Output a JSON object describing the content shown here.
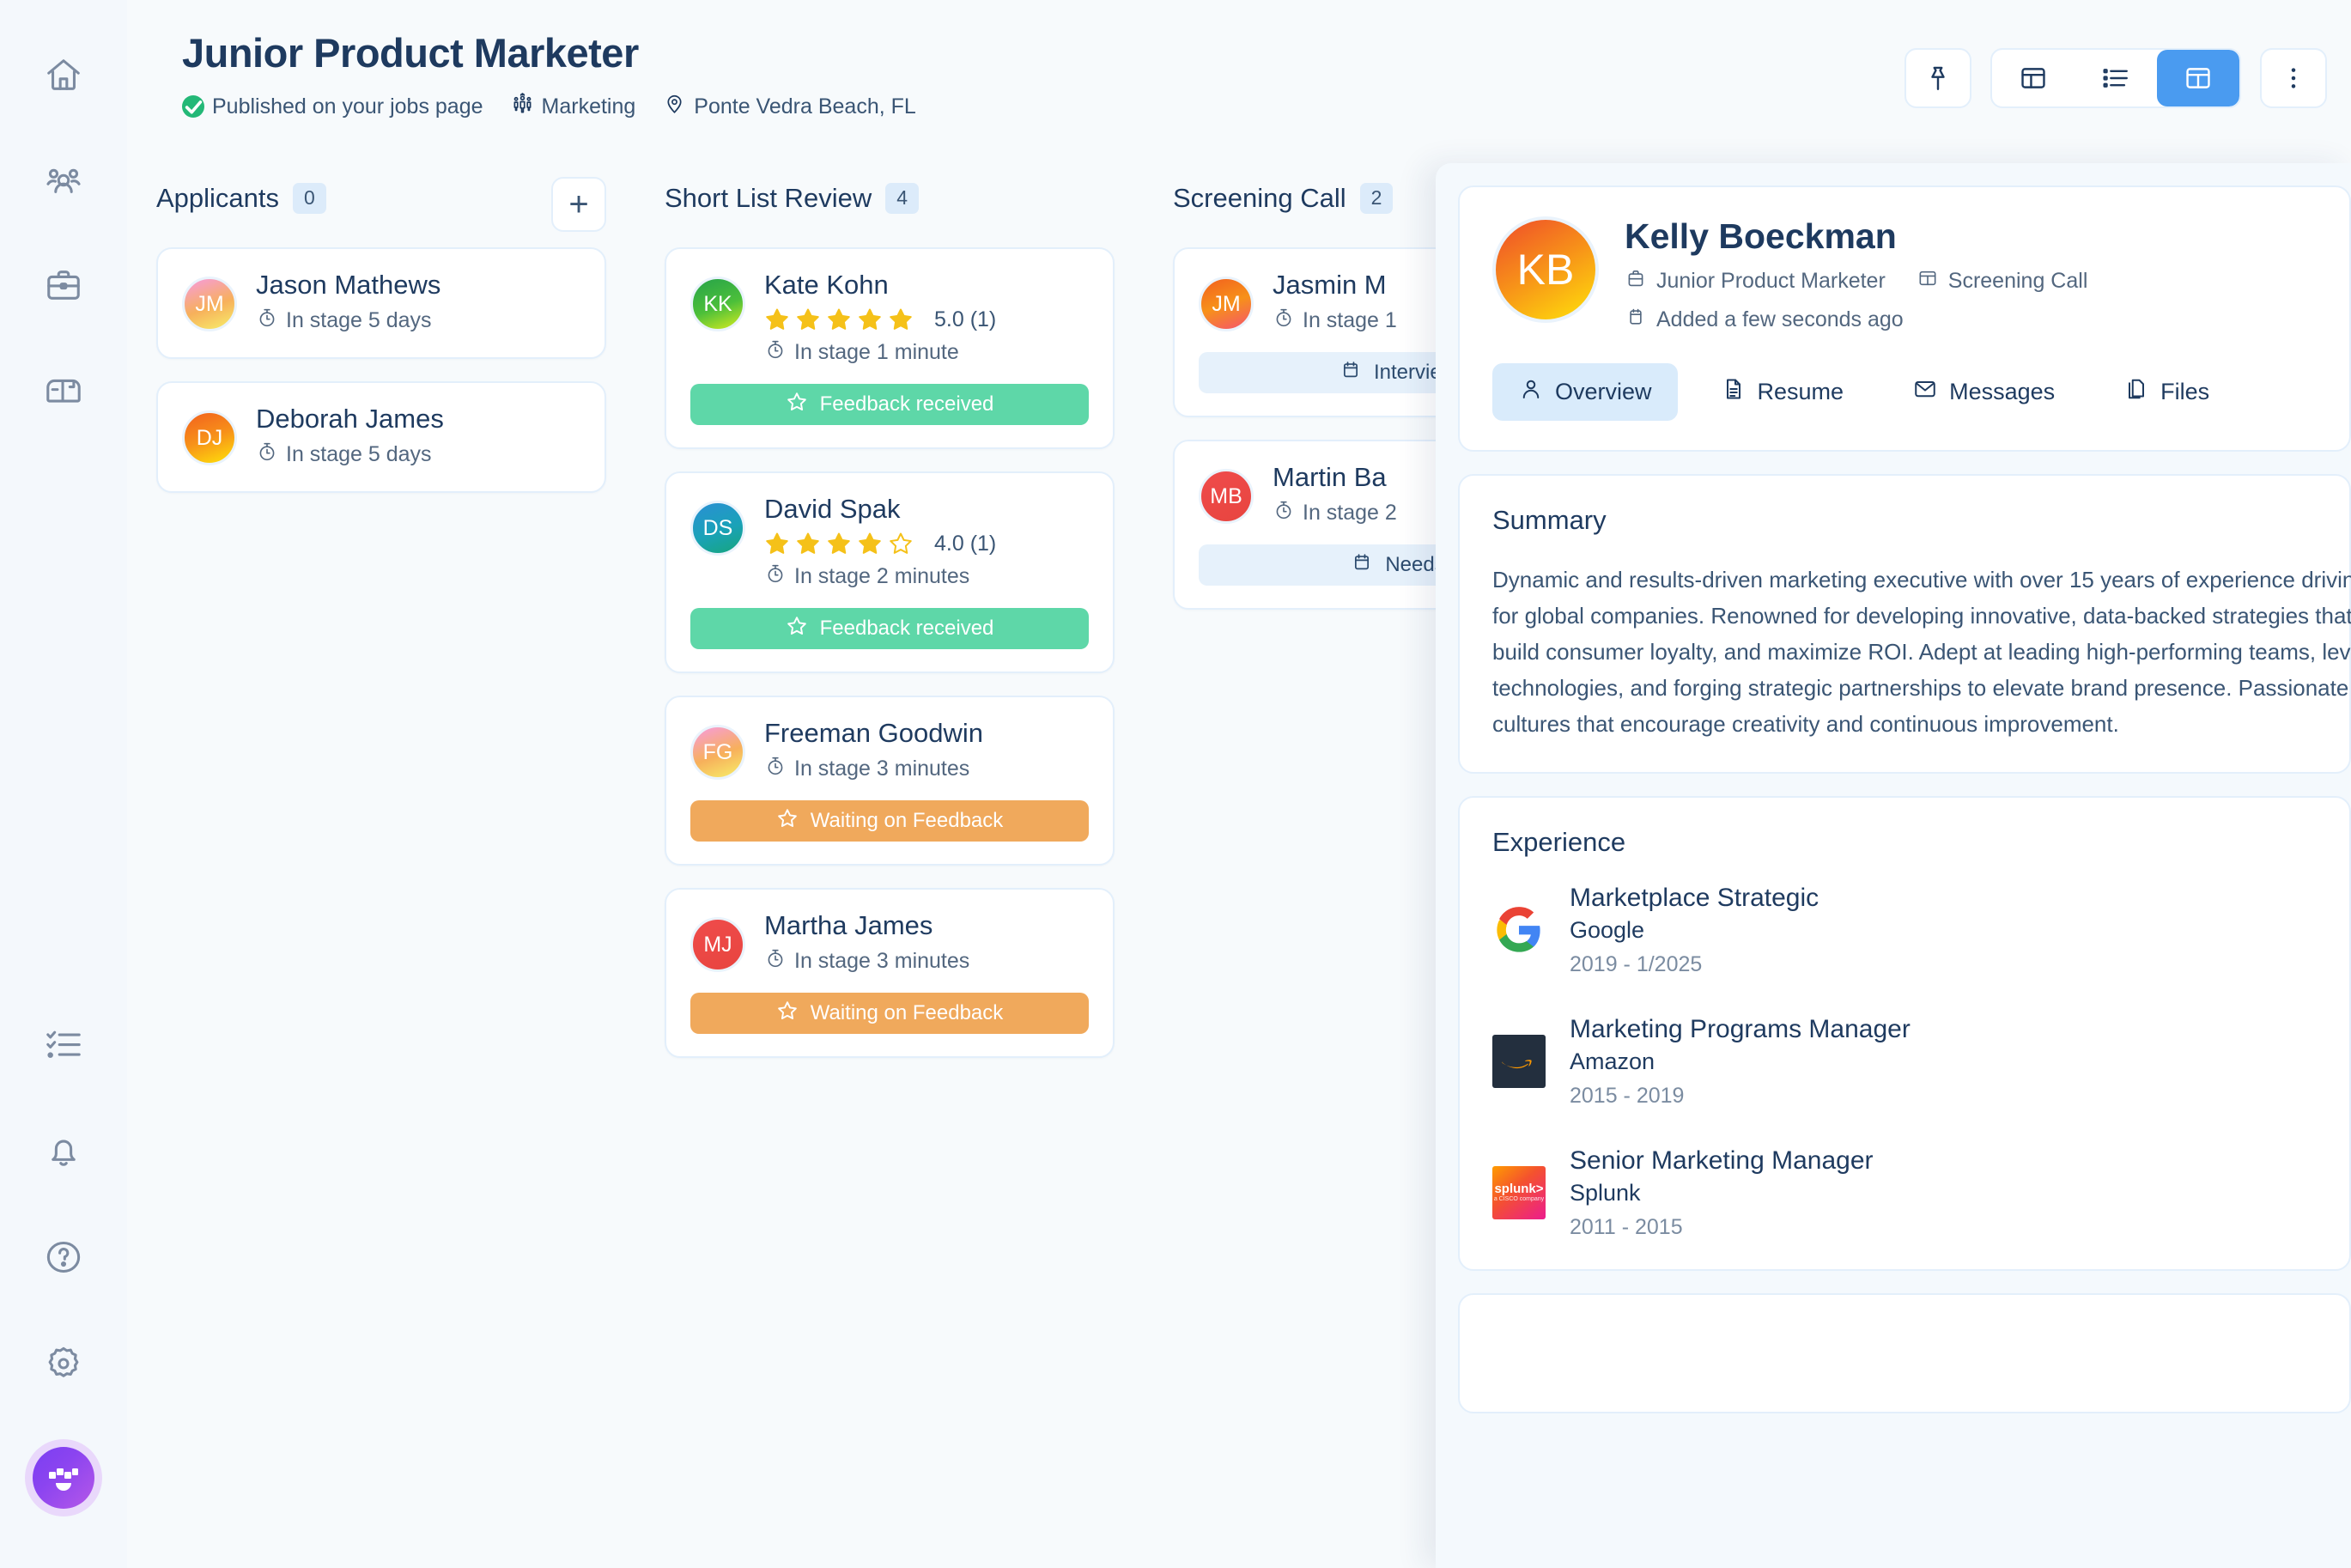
{
  "sidebar": {
    "top_items": [
      {
        "name": "home",
        "icon": "home-icon"
      },
      {
        "name": "people",
        "icon": "people-icon"
      },
      {
        "name": "jobs",
        "icon": "briefcase-icon"
      },
      {
        "name": "inbox",
        "icon": "mailbox-icon"
      }
    ],
    "bottom_items": [
      {
        "name": "tasks",
        "icon": "checklist-icon"
      },
      {
        "name": "notifications",
        "icon": "bell-icon"
      },
      {
        "name": "help",
        "icon": "question-circle-icon"
      },
      {
        "name": "settings",
        "icon": "gear-icon"
      }
    ],
    "account_avatar": "workstream-logo"
  },
  "header": {
    "title": "Junior Product Marketer",
    "published_label": "Published on your jobs page",
    "department": "Marketing",
    "location": "Ponte Vedra Beach, FL"
  },
  "toolbar": {
    "pin_label": "pin-icon",
    "view_panel_label": "panel-view-icon",
    "view_list_label": "list-view-icon",
    "view_split_label": "split-view-icon",
    "more_label": "more-vertical-icon",
    "active_view": "split-view-icon",
    "accent_color": "#4a9bf0"
  },
  "board": {
    "add_button_label": "+",
    "columns": [
      {
        "title": "Applicants",
        "count": "0",
        "has_add": true,
        "cards": [
          {
            "name": "Jason Mathews",
            "initials": "JM",
            "avatar_gradient": "linear-gradient(160deg,#f79be0 0%,#f7b05b 55%,#f7ef6a 100%)",
            "stage": "In stage 5 days",
            "rating": null,
            "rating_count": null,
            "pill": null
          },
          {
            "name": "Deborah James",
            "initials": "DJ",
            "avatar_gradient": "linear-gradient(160deg,#f2601f 0%,#f79119 50%,#ffe20a 100%)",
            "stage": "In stage 5 days",
            "rating": null,
            "rating_count": null,
            "pill": null
          }
        ]
      },
      {
        "title": "Short List Review",
        "count": "4",
        "has_add": false,
        "cards": [
          {
            "name": "Kate Kohn",
            "initials": "KK",
            "avatar_gradient": "linear-gradient(160deg,#26a34a 0%,#4cbf3a 55%,#d6ec1f 100%)",
            "stage": "In stage 1 minute",
            "rating": 5,
            "rating_text": "5.0 (1)",
            "pill": {
              "label": "Feedback received",
              "style": "green",
              "icon": "star-outline-icon"
            }
          },
          {
            "name": "David Spak",
            "initials": "DS",
            "avatar_gradient": "linear-gradient(160deg,#2a8fd4 0%,#1aa2b8 55%,#16a57c 100%)",
            "stage": "In stage 2 minutes",
            "rating": 4,
            "rating_text": "4.0 (1)",
            "pill": {
              "label": "Feedback received",
              "style": "green",
              "icon": "star-outline-icon"
            }
          },
          {
            "name": "Freeman Goodwin",
            "initials": "FG",
            "avatar_gradient": "linear-gradient(160deg,#f79be0 0%,#f7b05b 55%,#f7ef6a 100%)",
            "stage": "In stage 3 minutes",
            "rating": null,
            "rating_text": null,
            "pill": {
              "label": "Waiting on Feedback",
              "style": "orange",
              "icon": "star-outline-icon"
            }
          },
          {
            "name": "Martha James",
            "initials": "MJ",
            "avatar_gradient": "linear-gradient(160deg,#ef4b4b 0%,#e8453f 100%)",
            "stage": "In stage 3 minutes",
            "rating": null,
            "rating_text": null,
            "pill": {
              "label": "Waiting on Feedback",
              "style": "orange",
              "icon": "star-outline-icon"
            }
          }
        ]
      },
      {
        "title": "Screening Call",
        "count": "2",
        "has_add": false,
        "cards": [
          {
            "name": "Jasmin M",
            "initials": "JM",
            "avatar_gradient": "linear-gradient(160deg,#f2601f 0%,#f79119 50%,#f5536f 100%)",
            "stage": "In stage 1",
            "rating": null,
            "rating_text": null,
            "pill": {
              "label": "Interview",
              "style": "blue",
              "icon": "calendar-icon"
            }
          },
          {
            "name": "Martin Ba",
            "initials": "MB",
            "avatar_gradient": "linear-gradient(160deg,#ef4b4b 0%,#e8453f 100%)",
            "stage": "In stage 2",
            "rating": null,
            "rating_text": null,
            "pill": {
              "label": "Needs",
              "style": "blue",
              "icon": "calendar-icon"
            }
          }
        ]
      }
    ]
  },
  "detail": {
    "candidate": {
      "name": "Kelly Boeckman",
      "initials": "KB",
      "job_title": "Junior Product Marketer",
      "stage": "Screening Call",
      "added": "Added a few seconds ago"
    },
    "tabs": [
      {
        "label": "Overview",
        "icon": "person-icon",
        "active": true
      },
      {
        "label": "Resume",
        "icon": "document-icon",
        "active": false
      },
      {
        "label": "Messages",
        "icon": "envelope-icon",
        "active": false
      },
      {
        "label": "Files",
        "icon": "files-icon",
        "active": false
      }
    ],
    "summary": {
      "heading": "Summary",
      "text": "Dynamic and results-driven marketing executive with over 15 years of experience driving growth and market share for global companies. Renowned for developing innovative, data-backed strategies that consistently exceed KPIs, build consumer loyalty, and maximize ROI. Adept at leading high-performing teams, leveraging emerging technologies, and forging strategic partnerships to elevate brand presence. Passionate about fostering collaborative cultures that encourage creativity and continuous improvement."
    },
    "experience": {
      "heading": "Experience",
      "items": [
        {
          "title": "Marketplace Strategic",
          "company": "Google",
          "dates": "2019 - 1/2025",
          "logo": "google-logo"
        },
        {
          "title": "Marketing Programs Manager",
          "company": "Amazon",
          "dates": "2015 - 2019",
          "logo": "amazon-logo"
        },
        {
          "title": "Senior Marketing Manager",
          "company": "Splunk",
          "dates": "2011 - 2015",
          "logo": "splunk-logo"
        }
      ]
    },
    "splunk_wordmark": "splunk>",
    "splunk_subtext": "a CISCO company"
  }
}
